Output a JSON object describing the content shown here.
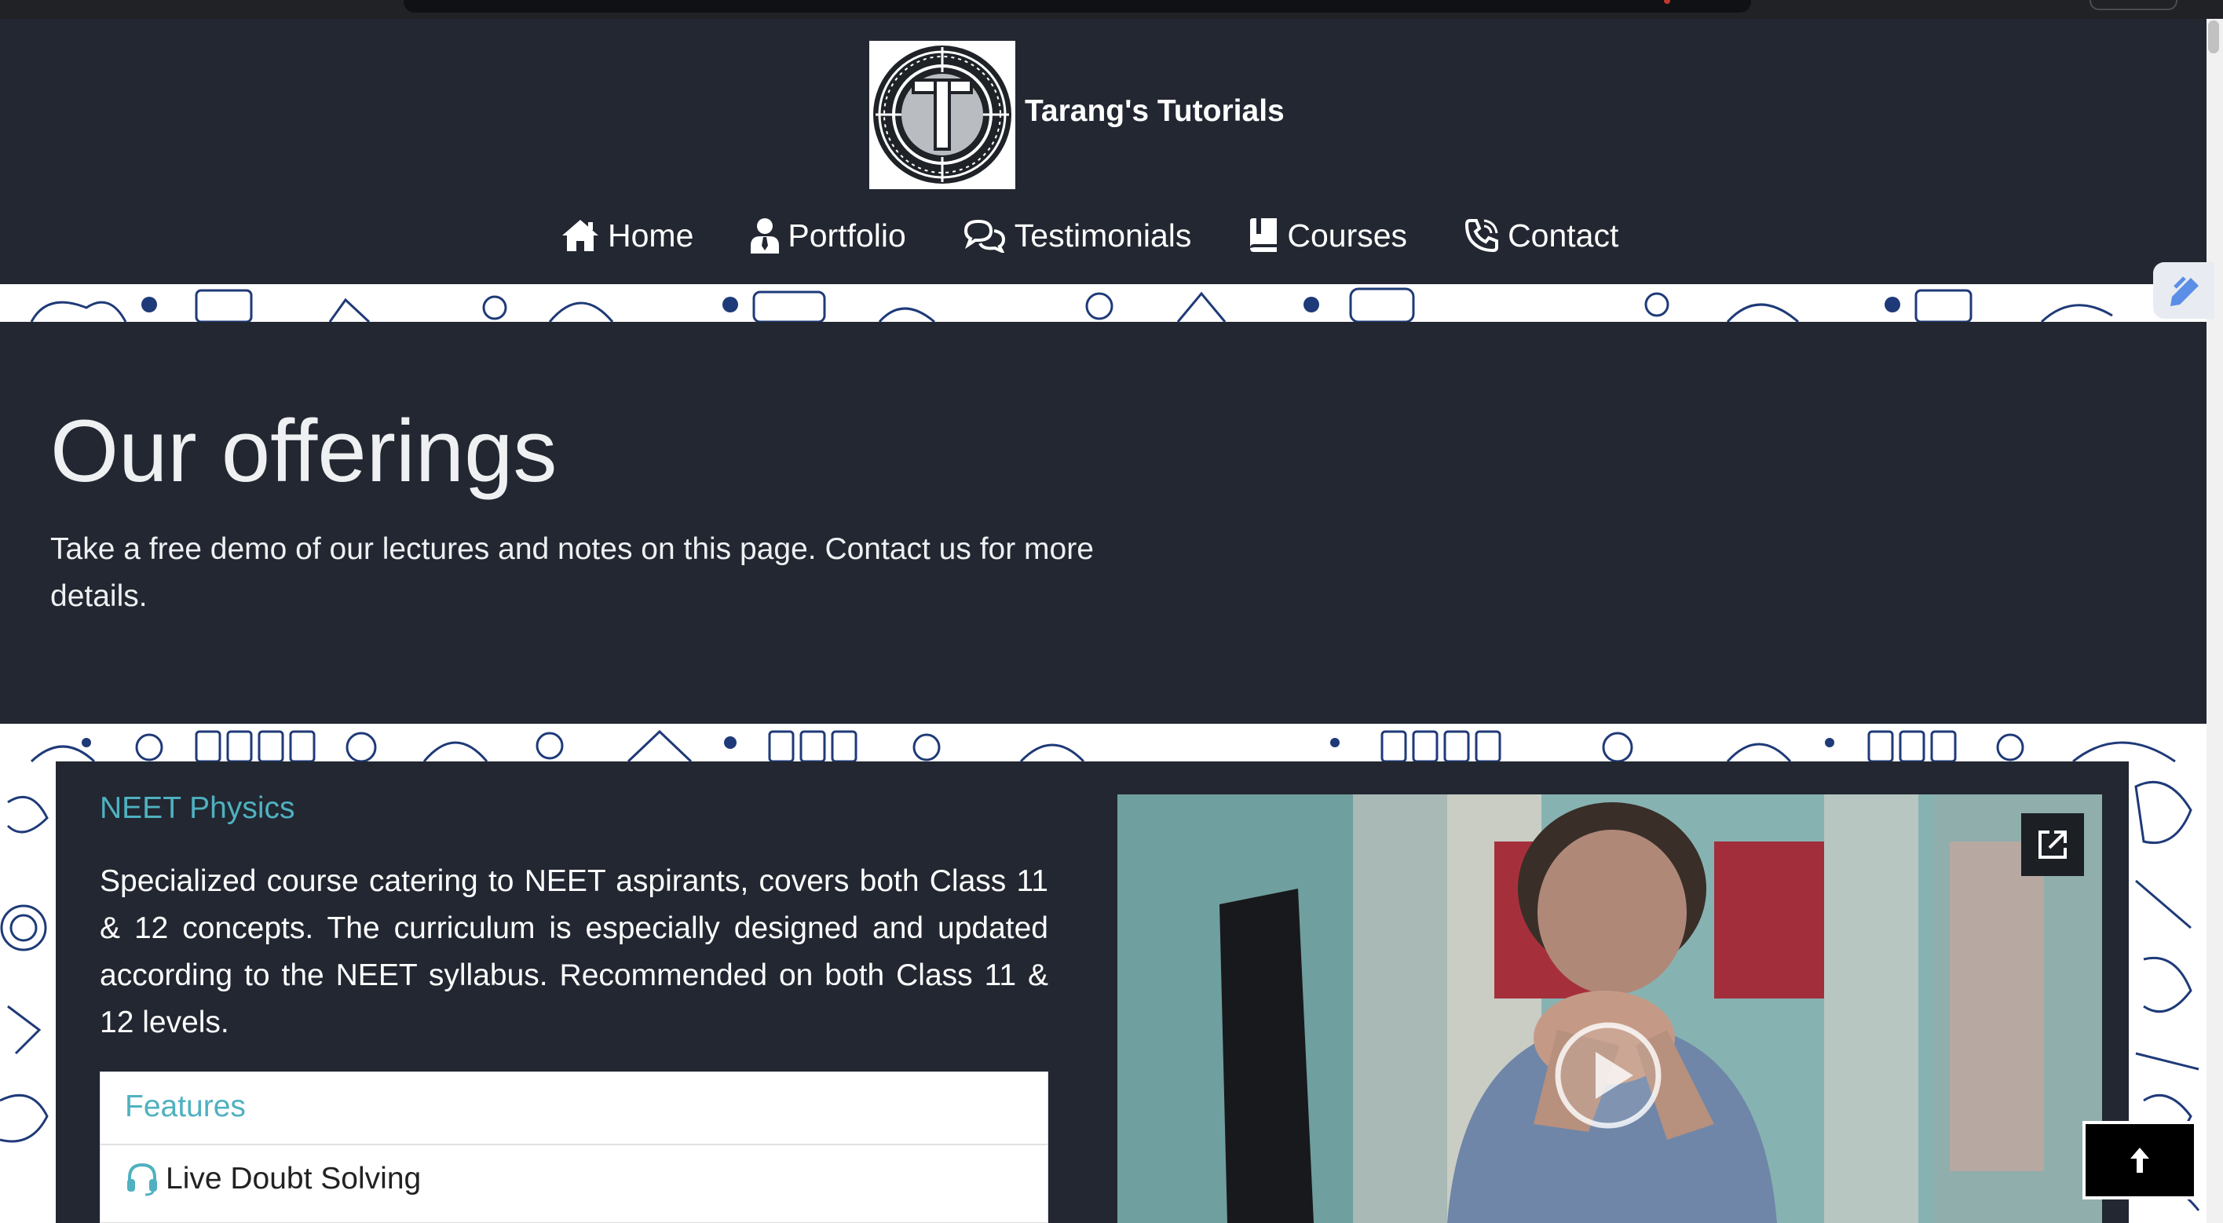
{
  "brand": {
    "name": "Tarang's Tutorials",
    "logo_letter": "T"
  },
  "nav": {
    "items": [
      {
        "label": "Home",
        "icon": "house-icon"
      },
      {
        "label": "Portfolio",
        "icon": "user-tie-icon"
      },
      {
        "label": "Testimonials",
        "icon": "comments-icon"
      },
      {
        "label": "Courses",
        "icon": "book-icon"
      },
      {
        "label": "Contact",
        "icon": "phone-volume-icon"
      }
    ]
  },
  "hero": {
    "title": "Our offerings",
    "description": "Take a free demo of our lectures and notes on this page. Contact us for more details."
  },
  "course": {
    "title": "NEET Physics",
    "description": "Specialized course catering to NEET aspirants, covers both Class 11 & 12 concepts. The curriculum is especially designed and updated according to the NEET syllabus. Recommended on both Class 11 & 12 levels.",
    "features_title": "Features",
    "features": [
      {
        "label": "Live Doubt Solving",
        "icon": "headset-icon"
      }
    ]
  },
  "video": {
    "open_external_icon": "open-external-icon",
    "play_icon": "play-icon"
  },
  "back_to_top": {
    "icon": "arrow-up-icon"
  },
  "colors": {
    "dark_bg": "#222731",
    "accent_teal": "#4fb1c0",
    "doodle_navy": "#1f3a78"
  }
}
